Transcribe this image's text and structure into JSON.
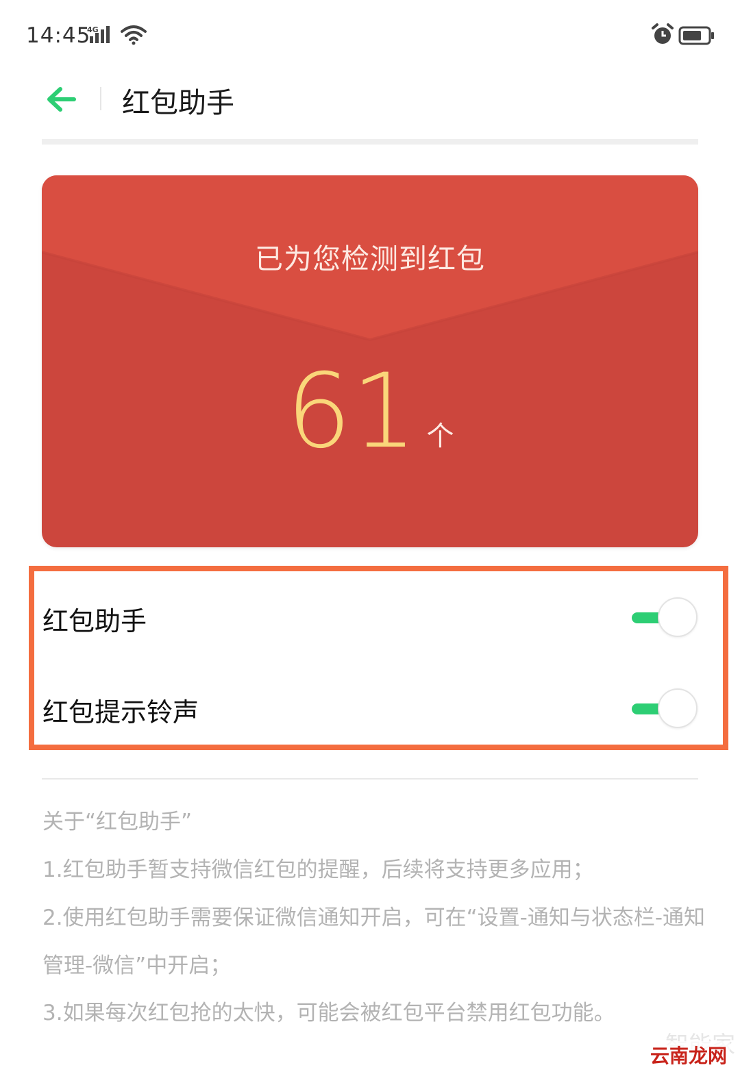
{
  "status_bar": {
    "time": "14:45",
    "network": "4G"
  },
  "header": {
    "title": "红包助手"
  },
  "card": {
    "subtitle": "已为您检测到红包",
    "count": "61",
    "unit": "个"
  },
  "settings": [
    {
      "label": "红包助手",
      "enabled": true
    },
    {
      "label": "红包提示铃声",
      "enabled": true
    }
  ],
  "about": {
    "title": "关于“红包助手”",
    "lines": [
      "1.红包助手暂支持微信红包的提醒，后续将支持更多应用；",
      "2.使用红包助手需要保证微信通知开启，可在“设置-通知与状态栏-通知",
      "管理-微信”中开启；",
      "3.如果每次红包抢的太快，可能会被红包平台禁用红包功能。"
    ]
  },
  "watermark": {
    "back_text": "智能家",
    "front_text": "云南龙网"
  },
  "colors": {
    "accent_green": "#2dce74",
    "card_red": "#cc463d",
    "card_flap_red": "#d94e41",
    "count_gold": "#fad67a",
    "highlight_orange": "#f46d3f"
  }
}
